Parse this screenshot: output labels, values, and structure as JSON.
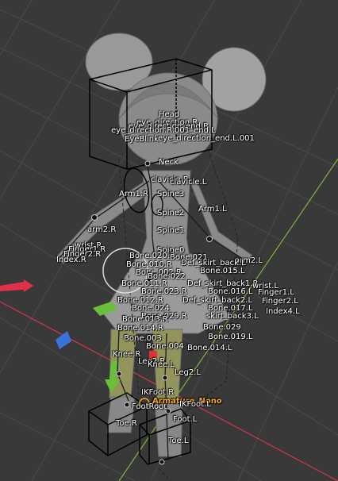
{
  "colors": {
    "background": "#393939",
    "grid_line": "#4a4a4a",
    "axis_x": "#d9344a",
    "axis_y": "#7fb43a",
    "active_label": "#f5a623",
    "label": "#ffffff"
  },
  "icons": {
    "x_axis_gizmo": "red-arrow-icon",
    "plane_gizmo_green": "green-plane-icon",
    "plane_gizmo_blue": "blue-plane-icon",
    "rotate_gizmo": "circle-gizmo-icon"
  },
  "bone_labels": {
    "head": "Head",
    "eye_direction_r": "eye_direction.R",
    "eye_direction_end_r": "eye_direction_end.R",
    "eye_direction_r_001_end_l": "eye_direction.R.001_end.L",
    "eye_blink": "EyeBlink",
    "eye_direction_end_l_001": "eye_direction_end.L.001",
    "neck": "Neck",
    "clavicle_r": "clavicle.R",
    "clavicle_l": "clavicle.L",
    "arm1_r": "Arm1.R",
    "spine3": "Spine3",
    "spine2": "Spine2",
    "arm1_l": "Arm1.L",
    "arm2_r": "arm2.R",
    "spine1": "Spine1",
    "wrist_r": "wrist.R",
    "finger1_r": "Finger1.R",
    "finger2_r": "Finger2.R",
    "index_r": "Index.R",
    "spine0": "Spine0",
    "bone_020_r": "Bone.020.R",
    "bone_021": "Bone.021",
    "arm2_l": "arm2.L",
    "bone_010_r": "Bone.010.R",
    "def_skirt_back_l": "Def_skirt_back.L",
    "bone_002_r": "Bone.002.R",
    "bone_015_l": "Bone.015.L",
    "bone_022": "Bone.022",
    "bone_011_r": "Bone.011.R",
    "def_skirt_back1_r": "Def_skirt_back1.R",
    "wrist_l": "wrist.L",
    "bone_023_r": "Bone.023.R",
    "bone_016_l": "Bone.016.L",
    "finger1_l": "Finger1.L",
    "bone_012_r": "Bone.012.R",
    "def_skirt_back2_l": "Def_skirt_back2.L",
    "finger2_l": "Finger2.L",
    "bone_024": "Bone.024",
    "bone_017_l": "Bone.017.L",
    "index4_l": "Index4.L",
    "bone_029_r": "Bone.029.R",
    "skirt_back3_l": "skirt_back3.L",
    "bone_013_r": "Bone.013.R",
    "bone_029": "Bone.029",
    "bone_014_r": "Bone.014.R",
    "bone_019_l": "Bone.019.L",
    "bone_003": "Bone.003",
    "bone_004": "Bone.004",
    "bone_014_l": "Bone.014.L",
    "knee_r": "Knee.R",
    "leg2_r": "Leg2.R",
    "knee_l": "Knee.L",
    "leg2_l": "Leg2.L",
    "ikfoot_r": "IKFoot.R",
    "footroot": "FootRoot",
    "armature_nono": "Armature_Nono",
    "ikfoot_l": "IKFoot.L",
    "foot_l": "Foot.L",
    "toe_r": "Toe.R",
    "toe_l": "Toe.L"
  }
}
